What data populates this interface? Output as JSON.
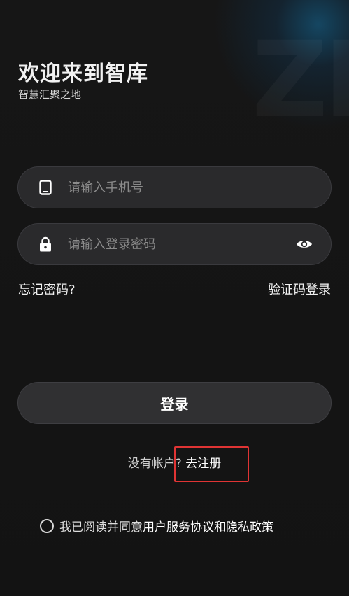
{
  "header": {
    "title": "欢迎来到智库",
    "subtitle": "智慧汇聚之地",
    "watermark": "ZK"
  },
  "form": {
    "phone": {
      "placeholder": "请输入手机号",
      "value": "",
      "icon": "phone-icon"
    },
    "password": {
      "placeholder": "请输入登录密码",
      "value": "",
      "icon": "lock-icon",
      "toggle_icon": "eye-icon"
    }
  },
  "links": {
    "forgot_password": "忘记密码?",
    "sms_login": "验证码登录"
  },
  "login_button": "登录",
  "register": {
    "question": "没有帐户?",
    "link": "去注册"
  },
  "agreement": {
    "prefix": "我已阅读并同意",
    "terms": "用户服务协议和隐私政策",
    "checked": false
  },
  "colors": {
    "background": "#141414",
    "field_bg": "#2a2a2c",
    "highlight": "#e03434",
    "glow": "#146ea0"
  }
}
